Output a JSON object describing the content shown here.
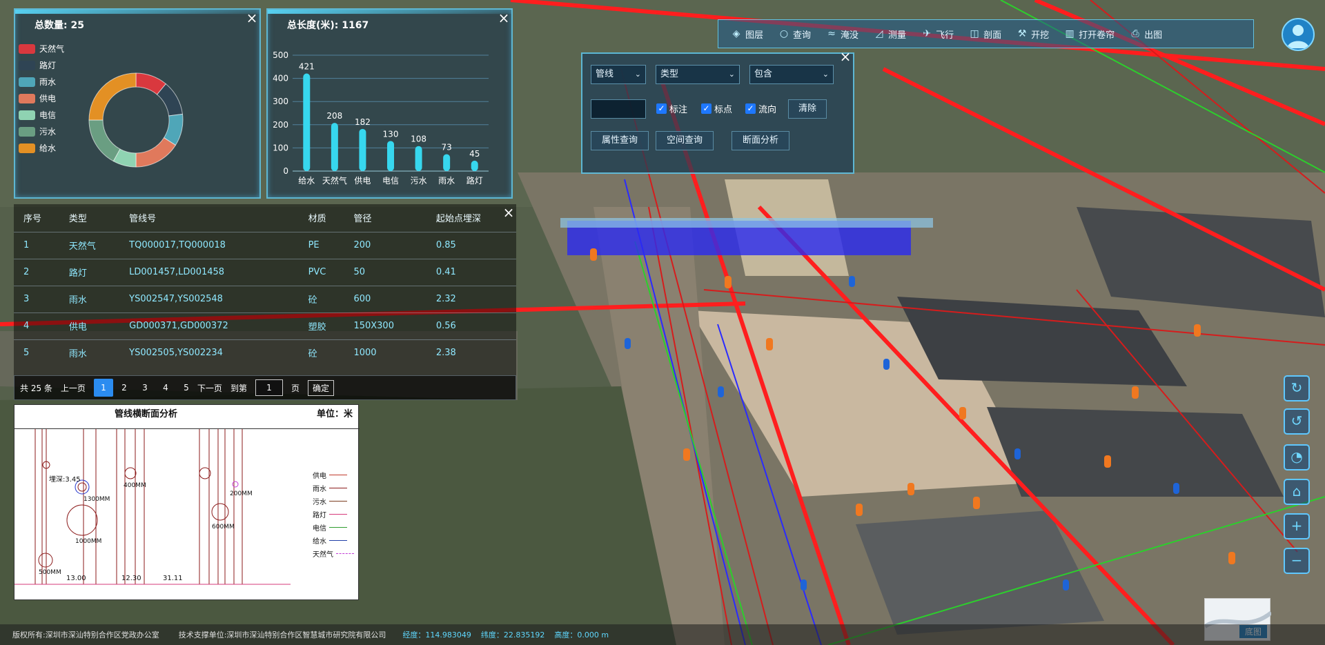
{
  "stats_panel": {
    "title": "总数量: 25",
    "legend": [
      {
        "label": "天然气",
        "color": "#d9383e"
      },
      {
        "label": "路灯",
        "color": "#2f4454"
      },
      {
        "label": "雨水",
        "color": "#4fa6b8"
      },
      {
        "label": "供电",
        "color": "#e0795c"
      },
      {
        "label": "电信",
        "color": "#8fd3b2"
      },
      {
        "label": "污水",
        "color": "#6a9e82"
      },
      {
        "label": "给水",
        "color": "#e39024"
      }
    ]
  },
  "length_panel": {
    "title": "总长度(米): 1167"
  },
  "chart_data": [
    {
      "type": "pie",
      "title": "总数量: 25",
      "donut": true,
      "labels": [
        "天然气",
        "路灯",
        "雨水",
        "供电",
        "电信",
        "污水",
        "给水"
      ],
      "values": [
        11,
        12,
        11,
        16,
        8,
        17,
        25
      ]
    },
    {
      "type": "bar",
      "title": "总长度(米): 1167",
      "categories": [
        "给水",
        "天然气",
        "供电",
        "电信",
        "污水",
        "雨水",
        "路灯"
      ],
      "values": [
        421,
        208,
        182,
        130,
        108,
        73,
        45
      ],
      "yticks": [
        0,
        100,
        200,
        300,
        400,
        500
      ],
      "ylim": [
        0,
        500
      ]
    }
  ],
  "toolbar": {
    "items": [
      {
        "label": "图层",
        "icon": "layers-icon"
      },
      {
        "label": "查询",
        "icon": "search-icon"
      },
      {
        "label": "淹没",
        "icon": "flood-icon"
      },
      {
        "label": "测量",
        "icon": "ruler-icon"
      },
      {
        "label": "飞行",
        "icon": "flight-icon"
      },
      {
        "label": "剖面",
        "icon": "cube-icon"
      },
      {
        "label": "开挖",
        "icon": "shovel-icon"
      },
      {
        "label": "打开卷帘",
        "icon": "curtain-icon"
      },
      {
        "label": "出图",
        "icon": "export-icon"
      }
    ]
  },
  "query": {
    "select1": "管线",
    "select2": "类型",
    "select3": "包含",
    "input_value": "",
    "chk1": "标注",
    "chk2": "标点",
    "chk3": "流向",
    "clear": "清除",
    "btn1": "属性查询",
    "btn2": "空间查询",
    "btn3": "断面分析"
  },
  "table": {
    "headers": [
      "序号",
      "类型",
      "管线号",
      "材质",
      "管径",
      "起始点埋深"
    ],
    "rows": [
      [
        "1",
        "天然气",
        "TQ000017,TQ000018",
        "PE",
        "200",
        "0.85"
      ],
      [
        "2",
        "路灯",
        "LD001457,LD001458",
        "PVC",
        "50",
        "0.41"
      ],
      [
        "3",
        "雨水",
        "YS002547,YS002548",
        "砼",
        "600",
        "2.32"
      ],
      [
        "4",
        "供电",
        "GD000371,GD000372",
        "塑胶",
        "150X300",
        "0.56"
      ],
      [
        "5",
        "雨水",
        "YS002505,YS002234",
        "砼",
        "1000",
        "2.38"
      ]
    ]
  },
  "pager": {
    "total": "共 25 条",
    "prev": "上一页",
    "pages": [
      "1",
      "2",
      "3",
      "4",
      "5"
    ],
    "next": "下一页",
    "goto": "到第",
    "page_value": "1",
    "page_unit": "页",
    "ok": "确定"
  },
  "section": {
    "title": "管线横断面分析",
    "unit": "单位：米",
    "legend": [
      {
        "label": "供电",
        "color": "#c0392b"
      },
      {
        "label": "雨水",
        "color": "#8b1a1a"
      },
      {
        "label": "污水",
        "color": "#7a3b1e"
      },
      {
        "label": "路灯",
        "color": "#d63a7a"
      },
      {
        "label": "电信",
        "color": "#2e9e2e"
      },
      {
        "label": "给水",
        "color": "#1f3ea8"
      },
      {
        "label": "天然气",
        "color": "#c23bd6"
      }
    ],
    "labels": {
      "d1": "埋深:3.45",
      "d2": "1300MM",
      "d3": "1000MM",
      "d4": "500MM",
      "d5": "400MM",
      "d6": "200MM",
      "d7": "600MM",
      "d8": "31.11",
      "d9": "13.00",
      "d10": "12.30"
    }
  },
  "footer": {
    "copyright": "版权所有:深圳市深汕特别合作区党政办公室",
    "support": "技术支撑单位:深圳市深汕特别合作区智慧城市研究院有限公司",
    "lng": "经度：114.983049",
    "lat": "纬度：22.835192",
    "alt": "高度：0.000 m"
  },
  "basemap": "底图"
}
